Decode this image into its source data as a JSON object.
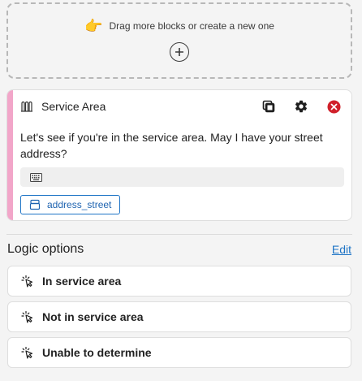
{
  "dropzone": {
    "hint": "Drag more blocks or create a new one",
    "hand_icon": "👉"
  },
  "block": {
    "title": "Service Area",
    "message": "Let's see if you're in the service area. May I have your street address?",
    "variable": "address_street",
    "accent_color": "#f2a6c9"
  },
  "logic": {
    "title": "Logic options",
    "edit_label": "Edit",
    "options": [
      {
        "label": "In service area"
      },
      {
        "label": "Not in service area"
      },
      {
        "label": "Unable to determine"
      }
    ]
  }
}
